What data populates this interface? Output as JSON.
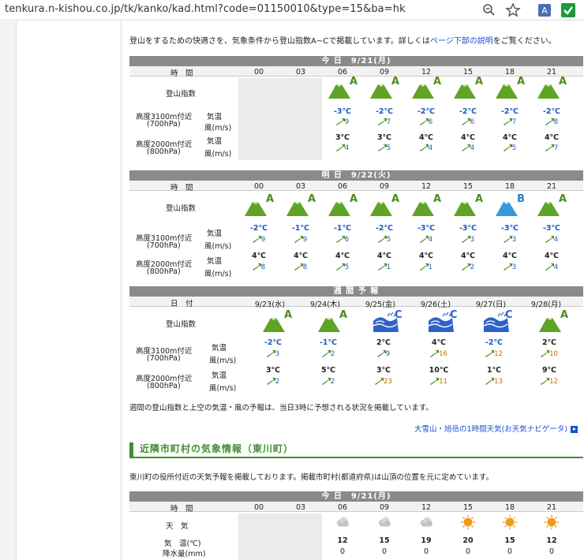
{
  "browser": {
    "url": "tenkura.n-kishou.co.jp/tk/kanko/kad.html?code=01150010&type=15&ba=hk"
  },
  "intro": {
    "text_before": "登山をするための快適さを、気象条件から登山指数A~Cで掲載しています。詳しくは",
    "link": "ページ下部の説明",
    "text_after": "をご覧ください。"
  },
  "hours": [
    "00",
    "03",
    "06",
    "09",
    "12",
    "15",
    "18",
    "21"
  ],
  "labels": {
    "time": "時　間",
    "index": "登山指数",
    "alt3100": "高度3100m付近",
    "hpa700": "(700hPa)",
    "alt2000": "高度2000m付近",
    "hpa800": "(800hPa)",
    "temp": "気温",
    "wind": "風(m/s)",
    "date": "日　付"
  },
  "today": {
    "title": "今 日　9/21(月)",
    "index": [
      "",
      "",
      "A",
      "A",
      "A",
      "A",
      "A",
      "A"
    ],
    "t700": [
      "",
      "",
      "-3℃",
      "-2℃",
      "-2℃",
      "-2℃",
      "-2℃",
      "-2℃"
    ],
    "w700": [
      "",
      "",
      "9",
      "7",
      "6",
      "6",
      "7",
      "8"
    ],
    "t800": [
      "",
      "",
      "3℃",
      "3℃",
      "4℃",
      "4℃",
      "4℃",
      "4℃"
    ],
    "w800": [
      "",
      "",
      "4",
      "5",
      "4",
      "4",
      "5",
      "7"
    ]
  },
  "tomorrow": {
    "title": "明 日　9/22(火)",
    "index": [
      "A",
      "A",
      "A",
      "A",
      "A",
      "A",
      "B",
      "A"
    ],
    "t700": [
      "-2℃",
      "-1℃",
      "-1℃",
      "-2℃",
      "-3℃",
      "-3℃",
      "-3℃",
      "-3℃"
    ],
    "w700": [
      "9",
      "9",
      "6",
      "5",
      "4",
      "3",
      "3",
      "4"
    ],
    "t800": [
      "4℃",
      "4℃",
      "4℃",
      "4℃",
      "4℃",
      "4℃",
      "4℃",
      "4℃"
    ],
    "w800": [
      "8",
      "8",
      "5",
      "1",
      "1",
      "2",
      "3",
      "4"
    ]
  },
  "weekly": {
    "title": "週 間 予 報",
    "dates": [
      "9/23(水)",
      "9/24(木)",
      "9/25(金)",
      "9/26(土)",
      "9/27(日)",
      "9/28(月)"
    ],
    "index": [
      "A",
      "A",
      "C",
      "C",
      "C",
      "A"
    ],
    "t700": [
      "-2℃",
      "-1℃",
      "2℃",
      "4℃",
      "-2℃",
      "2℃"
    ],
    "w700": [
      "3",
      "2",
      "9",
      "16",
      "12",
      "10"
    ],
    "t800": [
      "3℃",
      "5℃",
      "3℃",
      "10℃",
      "1℃",
      "9℃"
    ],
    "w800": [
      "2",
      "2",
      "23",
      "11",
      "13",
      "12"
    ],
    "footnote": "週間の登山指数と上空の気温・風の予報は、当日3時に予想される状況を掲載しています。",
    "link": "大雪山・旭岳の1時間天気(お天気ナビゲータ)"
  },
  "section2": {
    "heading": "近隣市町村の気象情報（東川町）",
    "desc": "東川町の役所付近の天気予報を掲載しております。掲載市町村(都道府県)は山頂の位置を元に定めています。",
    "title": "今 日　9/21(月)",
    "lbl_weather": "天　気",
    "lbl_temp": "気　温(℃)",
    "lbl_rain": "降水量(mm)",
    "temps": [
      "",
      "",
      "12",
      "15",
      "19",
      "20",
      "15",
      "12"
    ],
    "rain": [
      "",
      "",
      "0",
      "0",
      "0",
      "0",
      "0",
      "0"
    ],
    "weather": [
      "",
      "",
      "cloudy",
      "cloudy",
      "cloudy",
      "sunny",
      "sunny",
      "sunny"
    ]
  },
  "colors": {
    "mountain": "#5fa327",
    "mountain_b": "#3a9ad9",
    "index_a": "#4b8d1f",
    "index_b": "#2d7fc0",
    "blue_text": "#1a5bbf",
    "heading_green": "#3e8f2e",
    "header_gray": "#8a8a8a"
  }
}
